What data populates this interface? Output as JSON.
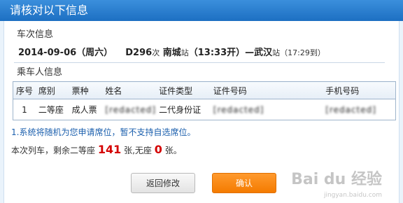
{
  "dialog": {
    "title": "请核对以下信息"
  },
  "train_section": {
    "heading": "车次信息",
    "date": "2014-09-06（周六）",
    "train_no": "D296",
    "ci": "次",
    "from": "南城",
    "from_suffix": "站",
    "depart": "（13:33开）—",
    "to": "武汉",
    "to_suffix": "站",
    "arrive": "（17:29到）"
  },
  "passenger_section": {
    "heading": "乘车人信息",
    "columns": [
      "序号",
      "席别",
      "票种",
      "姓名",
      "证件类型",
      "证件号码",
      "手机号码"
    ],
    "rows": [
      [
        "1",
        "二等座",
        "成人票",
        "[redacted]",
        "二代身份证",
        "[redacted]",
        "[redacted]"
      ]
    ]
  },
  "notice": "1.系统将随机为您申请席位，暂不支持自选席位。",
  "remaining": {
    "prefix": "本次列车，剩余二等座",
    "count": "141",
    "middle": "张,无座",
    "noseat": "0",
    "suffix": "张。"
  },
  "buttons": {
    "back": "返回修改",
    "confirm": "确认"
  },
  "watermark": {
    "text": "Bai du 经验",
    "sub": "jingyan.baidu.com"
  }
}
